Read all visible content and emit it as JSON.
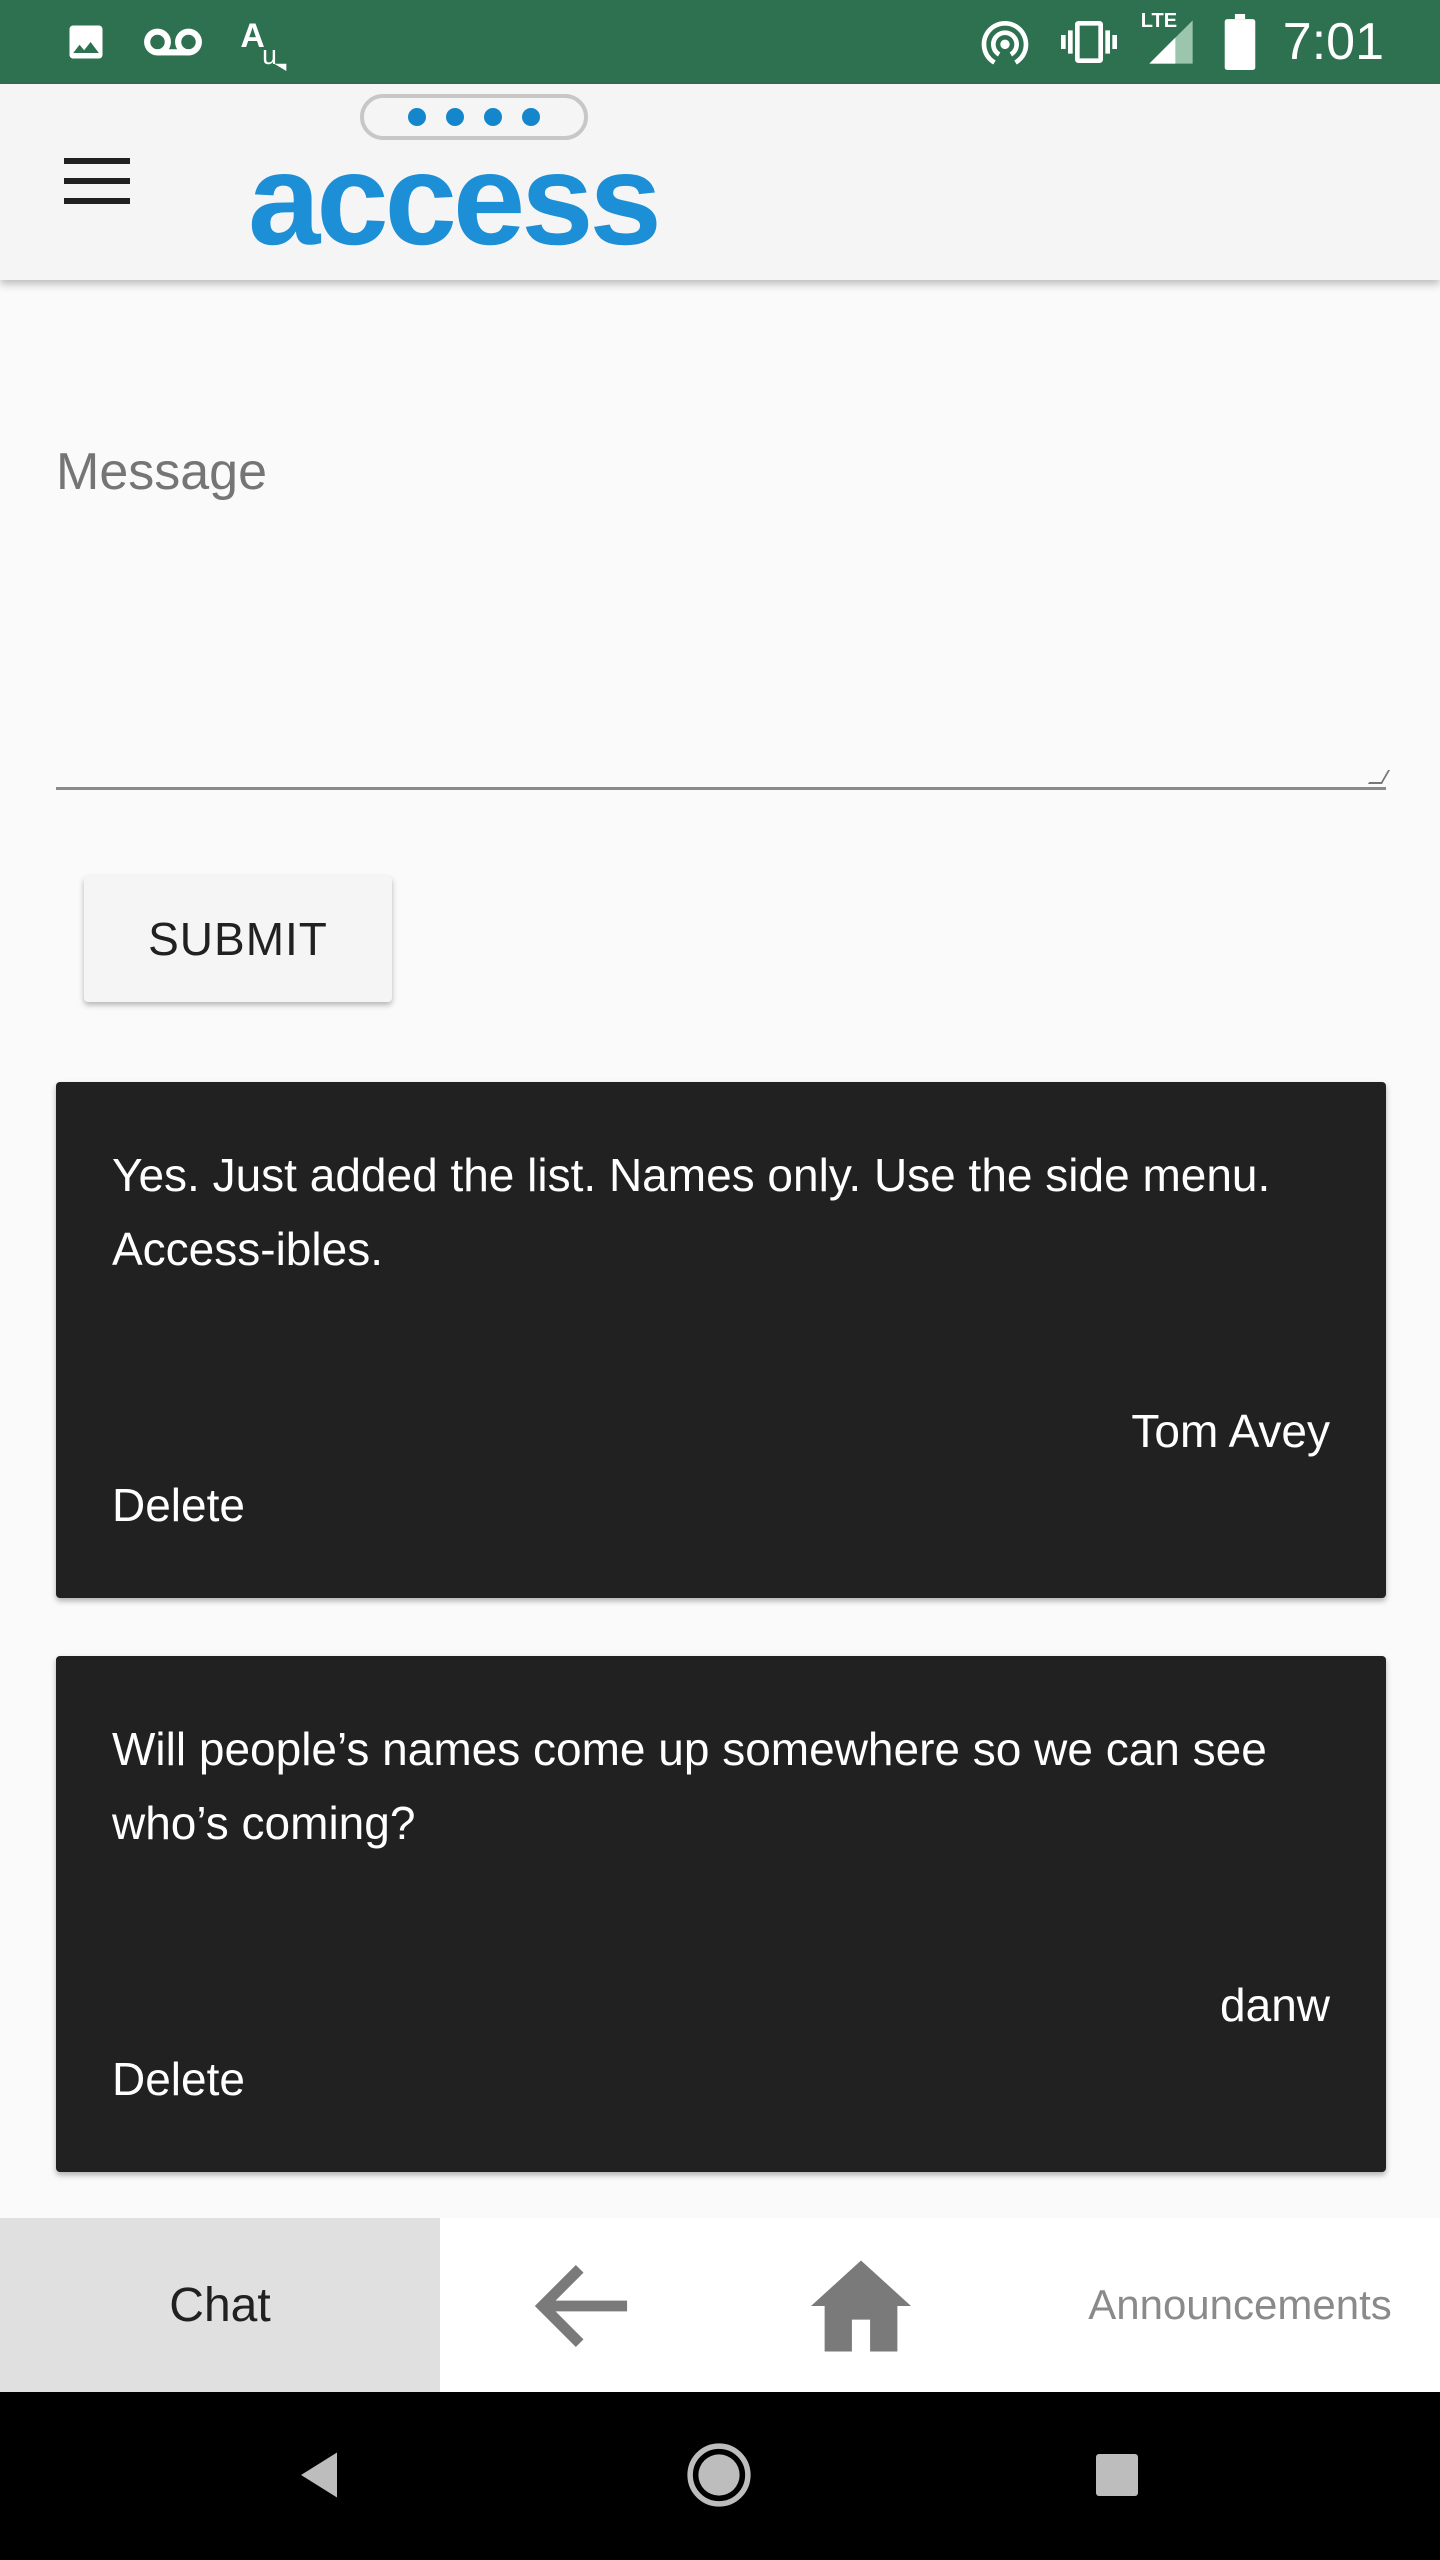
{
  "status_bar": {
    "time": "7:01",
    "network_label": "LTE",
    "background": "#2e7150",
    "left_icons": [
      "image-icon",
      "voicemail-icon",
      "translate-icon"
    ],
    "right_icons": [
      "hotspot-icon",
      "vibrate-icon",
      "signal-icon",
      "battery-icon"
    ]
  },
  "app_bar": {
    "logo_text": "access",
    "logo_color": "#1c8fd6",
    "menu_icon": "hamburger-menu-icon"
  },
  "compose": {
    "message_placeholder": "Message",
    "submit_label": "SUBMIT"
  },
  "messages": [
    {
      "text": "Yes. Just added the list. Names only. Use the side menu. Access-ibles.",
      "author": "Tom Avey",
      "delete_label": "Delete"
    },
    {
      "text": "Will people’s names come up somewhere so we can see who’s coming?",
      "author": "danw",
      "delete_label": "Delete"
    }
  ],
  "bottom_tabs": {
    "chat_label": "Chat",
    "back_icon": "arrow-left-icon",
    "home_icon": "home-icon",
    "announcements_label": "Announcements"
  },
  "colors": {
    "card_background": "#212121",
    "page_background": "#fafafa"
  }
}
